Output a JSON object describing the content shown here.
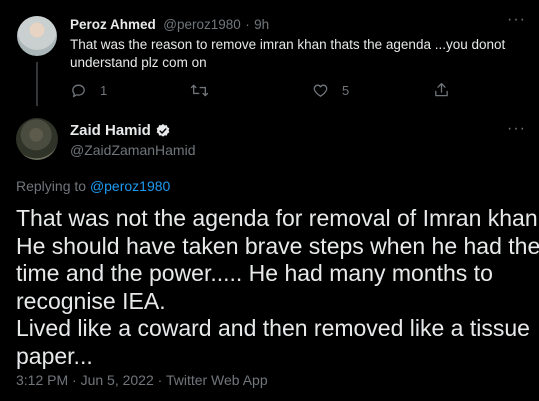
{
  "reply_tweet": {
    "author_name": "Peroz Ahmed",
    "author_handle": "@peroz1980",
    "time_separator": "·",
    "time": "9h",
    "text_line1": "That was the reason to remove imran khan  thats the agenda ...you donot",
    "text_line2": "understand  plz com on",
    "actions": {
      "reply_count": "1",
      "retweet_count": "",
      "like_count": "5"
    },
    "more_label": "···"
  },
  "main_tweet": {
    "author_name": "Zaid Hamid",
    "author_handle": "@ZaidZamanHamid",
    "more_label": "···",
    "replying_prefix": "Replying to ",
    "replying_handle": "@peroz1980",
    "text_lines": [
      "That was not the agenda for removal of Imran khan.",
      "He should have taken brave steps when he had the",
      "time and the power..... He had many months to",
      "recognise IEA.",
      "Lived like a coward and then removed like a tissue",
      "paper..."
    ],
    "meta": "3:12 PM · Jun 5, 2022 · Twitter Web App"
  },
  "colors": {
    "background": "#000000",
    "text_primary": "#e7e9ea",
    "text_muted": "#71767b",
    "link": "#1d9bf0",
    "separator": "#2f3336"
  }
}
